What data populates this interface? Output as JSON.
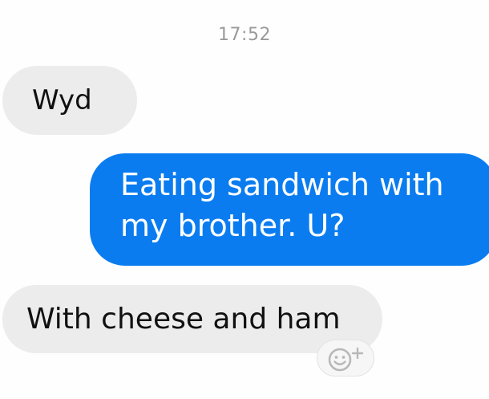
{
  "conversation": {
    "timestamp": "17:52",
    "messages": [
      {
        "direction": "incoming",
        "lines": [
          "Wyd"
        ]
      },
      {
        "direction": "outgoing",
        "lines": [
          "Eating sandwich with",
          "my brother. U?"
        ]
      },
      {
        "direction": "incoming",
        "lines": [
          "With cheese and ham"
        ]
      }
    ]
  },
  "reaction": {
    "icon": "add-reaction-icon"
  },
  "colors": {
    "outgoing_bubble": "#0a7cf0",
    "incoming_bubble": "#ececec",
    "timestamp_text": "#9a9a9a"
  }
}
